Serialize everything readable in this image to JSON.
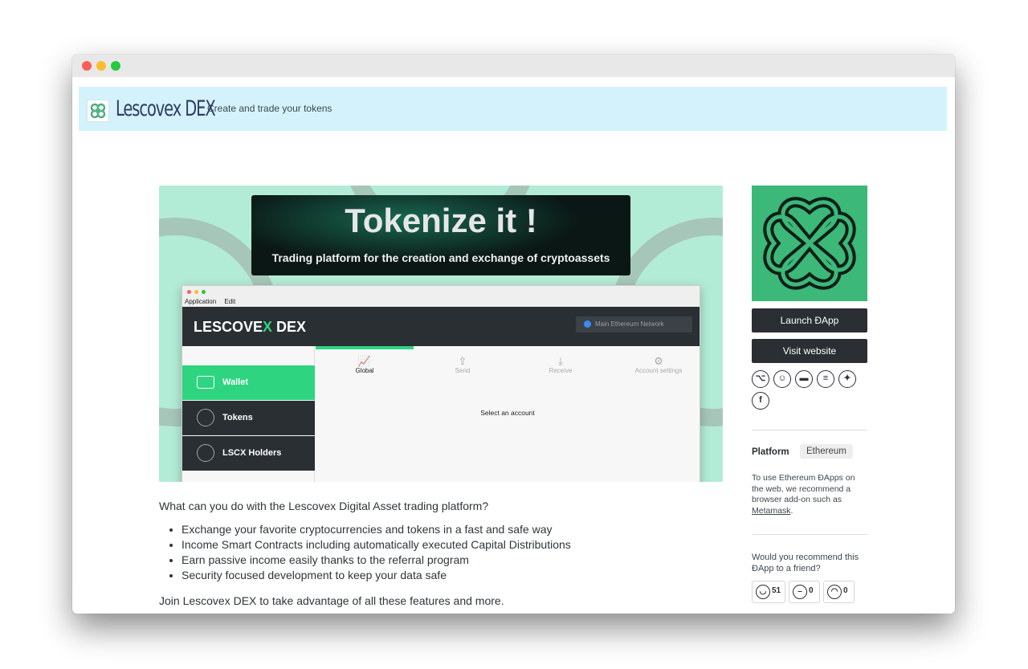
{
  "header": {
    "logo_text": "Lescovex DEX",
    "tagline": "Create and trade your tokens"
  },
  "hero": {
    "banner_title": "Tokenize it !",
    "banner_subtitle": "Trading platform for the creation and exchange of cryptoassets",
    "mockup": {
      "menu": [
        "Application",
        "Edit"
      ],
      "brand_prefix": "LESCOVE",
      "brand_x": "X",
      "brand_suffix": " DEX",
      "network": "Main Ethereum Network",
      "tabs": [
        {
          "label": "Global",
          "icon": "chart-icon"
        },
        {
          "label": "Send",
          "icon": "upload-icon"
        },
        {
          "label": "Receive",
          "icon": "download-icon"
        },
        {
          "label": "Account settings",
          "icon": "gear-icon"
        }
      ],
      "sidebar": [
        {
          "label": "Wallet",
          "icon": "wallet-icon"
        },
        {
          "label": "Tokens",
          "icon": "ethereum-icon"
        },
        {
          "label": "LSCX Holders",
          "icon": "ethereum-icon"
        }
      ],
      "message": "Select an account",
      "colors": {
        "accent": "#2fd481",
        "dark": "#2a2f33"
      }
    }
  },
  "description": {
    "intro": "What can you do with the Lescovex Digital Asset trading platform?",
    "bullets": [
      "Exchange your favorite cryptocurrencies and tokens in a fast and safe way",
      "Income Smart Contracts including automatically executed Capital Distributions",
      "Earn passive income easily thanks to the referral program",
      "Security focused development to keep your data safe"
    ],
    "outro": "Join Lescovex DEX to take advantage of all these features and more."
  },
  "sidebar": {
    "launch_label": "Launch ÐApp",
    "visit_label": "Visit website",
    "social_icons": [
      "github-icon",
      "reddit-icon",
      "chat-icon",
      "blog-icon",
      "twitter-icon",
      "facebook-icon"
    ],
    "platform_label": "Platform",
    "platform_value": "Ethereum",
    "note_text": "To use Ethereum ÐApps on the web, we recommend a browser add-on such as ",
    "note_link": "Metamask",
    "note_end": ".",
    "question": "Would you recommend this ÐApp to a friend?",
    "votes": [
      {
        "icon": "smile-icon",
        "count": "51"
      },
      {
        "icon": "neutral-icon",
        "count": "0"
      },
      {
        "icon": "sad-icon",
        "count": "0"
      }
    ],
    "brand_color": "#3cb879"
  }
}
